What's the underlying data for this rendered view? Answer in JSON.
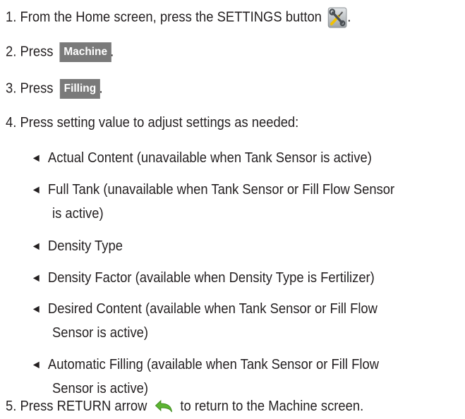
{
  "steps": {
    "step1_text": "1. From the Home screen, press the SETTINGS button",
    "step1_end": ".",
    "step2_prefix": "2. Press",
    "step2_button": "Machine",
    "step2_end": ".",
    "step3_prefix": "3. Press",
    "step3_button": "Filling",
    "step3_end": ".",
    "step4_text": "4. Press setting value to adjust settings as needed:",
    "step5_prefix": "5. Press RETURN arrow",
    "step5_suffix": "to return to the Machine screen."
  },
  "bullet_glyph": "◄",
  "settings_list": [
    {
      "line1": "Actual Content (unavailable when Tank Sensor is active)"
    },
    {
      "line1": "Full Tank (unavailable when Tank Sensor or Fill Flow Sensor",
      "line2": "is active)"
    },
    {
      "line1": "Density Type"
    },
    {
      "line1": "Density Factor (available when Density Type is Fertilizer)"
    },
    {
      "line1": "Desired Content (available when Tank Sensor or Fill Flow",
      "line2": "Sensor is active)"
    },
    {
      "line1": "Automatic Filling (available when Tank Sensor or Fill Flow",
      "line2": "Sensor is active)"
    }
  ],
  "icons": {
    "settings": "settings-wrench-screwdriver-icon",
    "return": "return-arrow-icon"
  },
  "colors": {
    "text": "#231f20",
    "button_bg": "#7a7a7a",
    "button_text": "#ffffff",
    "return_arrow": "#5cb531",
    "settings_bg": "#bfc3c6"
  }
}
